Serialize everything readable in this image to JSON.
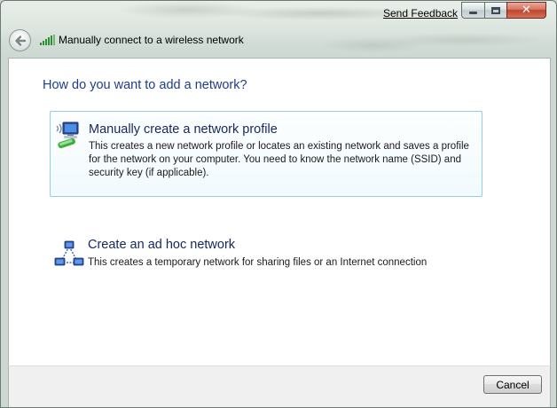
{
  "window": {
    "send_feedback": "Send Feedback",
    "nav_title": "Manually connect to a wireless network"
  },
  "content": {
    "heading": "How do you want to add a network?",
    "options": [
      {
        "title": "Manually create a network profile",
        "description": "This creates a new network profile or locates an existing network and saves a profile for the network on your computer. You need to know the network name (SSID) and security key (if applicable).",
        "icon": "network-profile-icon"
      },
      {
        "title": "Create an ad hoc network",
        "description": "This creates a temporary network for sharing files or an Internet connection",
        "icon": "ad-hoc-network-icon"
      }
    ]
  },
  "footer": {
    "cancel_label": "Cancel"
  },
  "colors": {
    "heading": "#1e3e8a",
    "option_title": "#15275c",
    "option_highlight_border": "#8fd0e6",
    "close_button": "#c0432b"
  }
}
